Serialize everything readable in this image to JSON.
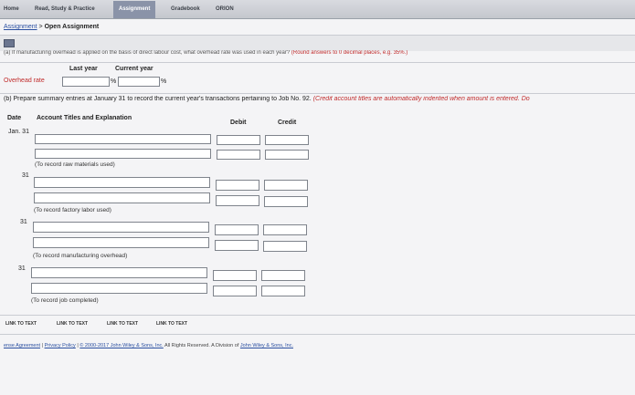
{
  "nav": {
    "tabs": [
      {
        "label": "Home"
      },
      {
        "label": "Read, Study & Practice"
      },
      {
        "label": "Assignment"
      },
      {
        "label": "Gradebook"
      },
      {
        "label": "ORION"
      }
    ]
  },
  "breadcrumb": {
    "link": "Assignment",
    "separator": ">",
    "current": "Open Assignment"
  },
  "part_a": {
    "question_cut": "(a) If manufacturing overhead is applied on the basis of direct labour cost, what overhead rate was used in each year?",
    "instruction": "(Round answers to 0 decimal places, e.g. 35%.)",
    "col_last_year": "Last year",
    "col_current_year": "Current year",
    "row_label": "Overhead rate",
    "last_year_value": "",
    "current_year_value": "",
    "pct_symbol": "%"
  },
  "part_b": {
    "question": "(b) Prepare summary entries at January 31 to record the current year's transactions pertaining to Job No. 92.",
    "instruction": "(Credit account titles are automatically indented when amount is entered. Do"
  },
  "journal": {
    "headers": {
      "date": "Date",
      "account": "Account Titles and Explanation",
      "debit": "Debit",
      "credit": "Credit"
    },
    "entries": [
      {
        "date": "Jan. 31",
        "memo": "(To record raw materials used)"
      },
      {
        "date": "31",
        "memo": "(To record factory labor used)"
      },
      {
        "date": "31",
        "memo": "(To record manufacturing overhead)"
      },
      {
        "date": "31",
        "memo": "(To record job completed)"
      }
    ]
  },
  "links": {
    "items": [
      "LINK TO TEXT",
      "LINK TO TEXT",
      "LINK TO TEXT",
      "LINK TO TEXT"
    ]
  },
  "footer": {
    "license": "ense Agreement",
    "sep1": "|",
    "privacy": "Privacy Policy",
    "sep2": "|",
    "copyright": "© 2000-2017 John Wiley & Sons, Inc.",
    "rights": "All Rights Reserved. A Division of",
    "company": "John Wiley & Sons, Inc."
  }
}
